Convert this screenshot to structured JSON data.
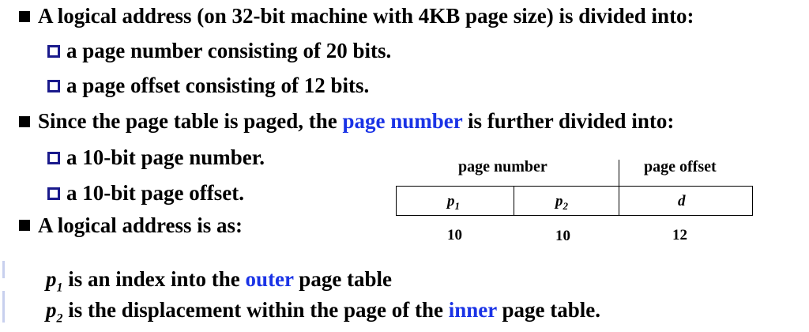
{
  "bullets": [
    {
      "text": "A logical address (on 32-bit machine with 4KB page size) is divided into:"
    },
    {
      "before": "Since the page table is paged, the ",
      "highlight": "page number",
      "after": " is further divided into:"
    },
    {
      "text": "A logical address is as:"
    }
  ],
  "sub_bullets_1": [
    {
      "text": "a page number consisting of 20 bits."
    },
    {
      "text": "a page offset consisting of 12 bits."
    }
  ],
  "sub_bullets_2": [
    {
      "text": "a 10-bit page number."
    },
    {
      "text": "a 10-bit page offset."
    }
  ],
  "diagram": {
    "page_number_label": "page number",
    "page_offset_label": "page offset",
    "cells": [
      {
        "var": "p",
        "sub": "1",
        "bits": "10"
      },
      {
        "var": "p",
        "sub": "2",
        "bits": "10"
      },
      {
        "var": "d",
        "sub": "",
        "bits": "12"
      }
    ]
  },
  "notes": [
    {
      "var": "p",
      "sub": "1",
      "before": " is an index into the ",
      "highlight": "outer",
      "after": " page table"
    },
    {
      "var": "p",
      "sub": "2",
      "before": " is the displacement within the page of the ",
      "highlight": "inner",
      "after": " page table."
    }
  ],
  "colors": {
    "highlight": "#1a33e6",
    "sub_bullet_box": "#1a1a8c"
  }
}
